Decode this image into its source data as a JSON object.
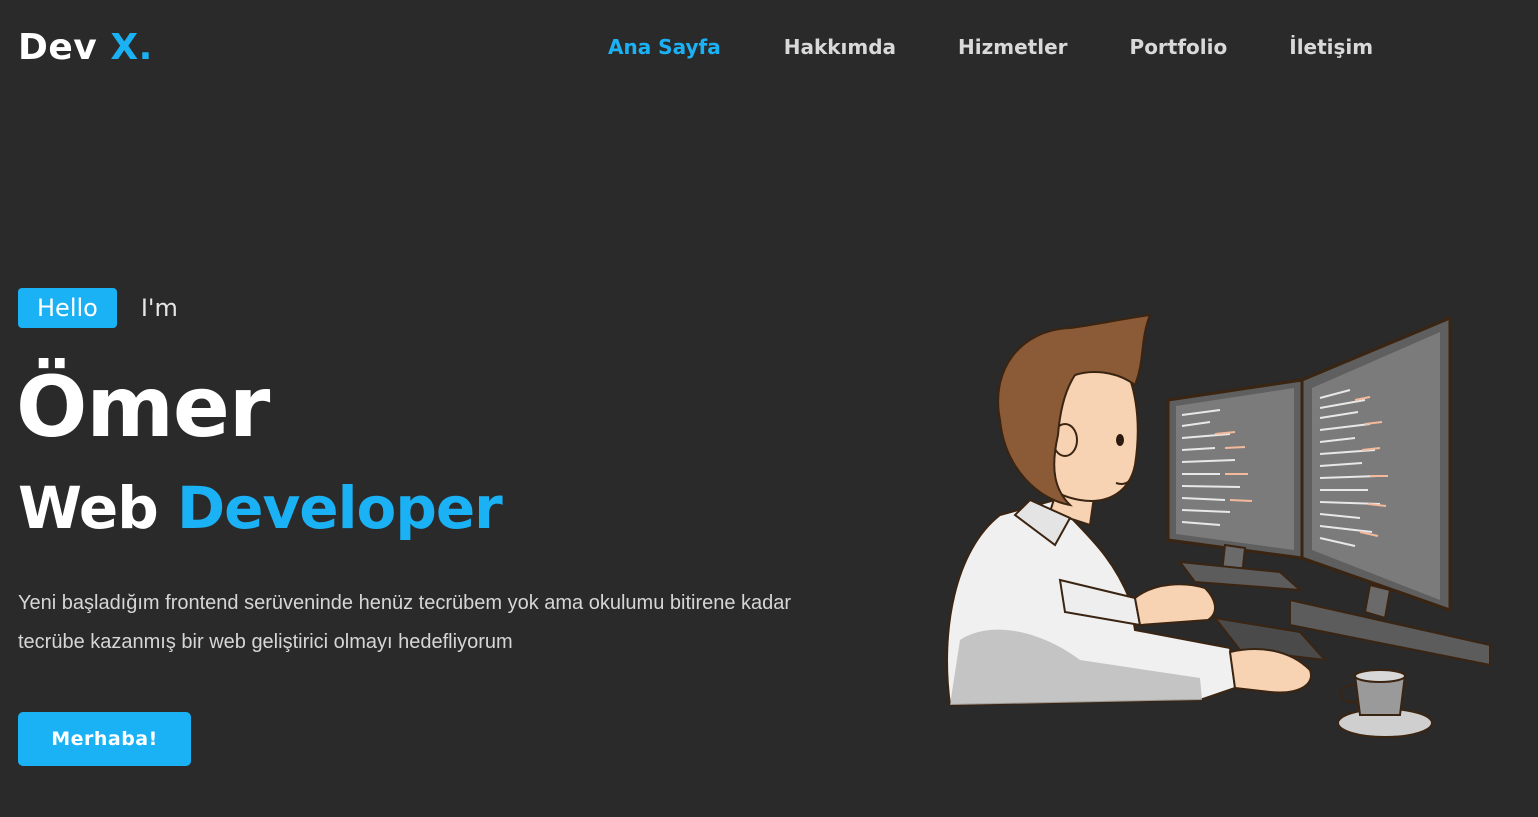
{
  "header": {
    "logo_text": "Dev",
    "logo_accent": "X.",
    "nav": [
      {
        "label": "Ana Sayfa",
        "active": true
      },
      {
        "label": "Hakkımda",
        "active": false
      },
      {
        "label": "Hizmetler",
        "active": false
      },
      {
        "label": "Portfolio",
        "active": false
      },
      {
        "label": "İletişim",
        "active": false
      }
    ]
  },
  "hero": {
    "hello": "Hello",
    "im": "I'm",
    "name": "Ömer",
    "role_prefix": "Web",
    "role_accent": "Developer",
    "description": "Yeni başladığım frontend serüveninde henüz tecrübem yok ama okulumu bitirene kadar tecrübe kazanmış bir web geliştirici olmayı hedefliyorum",
    "cta_label": "Merhaba!"
  },
  "colors": {
    "background": "#2a2a2a",
    "accent": "#1ab2f5",
    "text": "#ffffff"
  },
  "illustration": {
    "icon": "developer-at-computer-illustration"
  }
}
